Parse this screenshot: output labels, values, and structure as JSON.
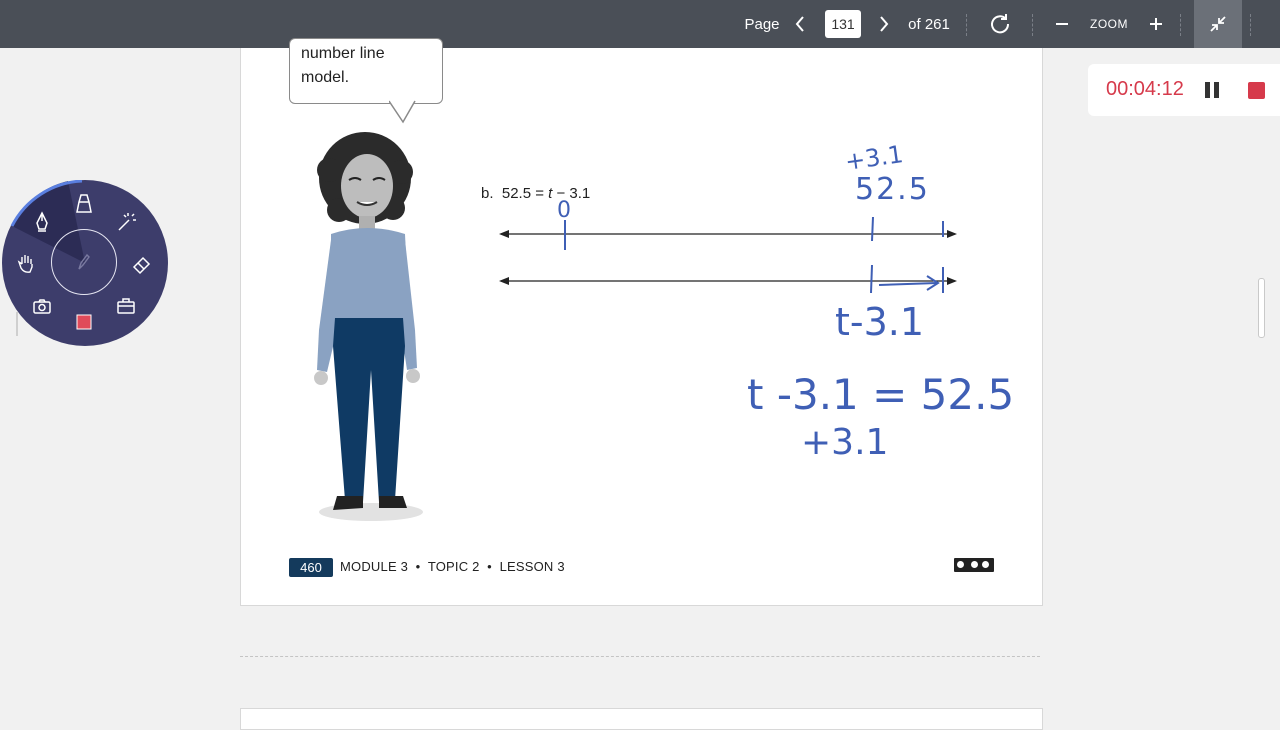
{
  "toolbar": {
    "page_label": "Page",
    "page_value": "131",
    "page_total": "of 261",
    "zoom_label": "ZOOM"
  },
  "page": {
    "bubble_text_line1": "number line",
    "bubble_text_line2": "model.",
    "problem_prefix": "b.",
    "problem_lhs": "52.5 =",
    "problem_var": "t",
    "problem_rhs": "− 3.1",
    "footer_page_number": "460",
    "footer_module": "MODULE 3",
    "footer_topic": "TOPIC 2",
    "footer_lesson": "LESSON 3",
    "handwriting": {
      "top_left_label": "+3.1",
      "top_value": "52.5",
      "start_label": "0",
      "below_line_label": "t-3.1",
      "equation": "t -3.1 = 52.5",
      "add_line": "+3.1"
    }
  },
  "timer": {
    "elapsed": "00:04:12"
  },
  "colors": {
    "toolbar_bg": "#4a4f57",
    "ink_blue": "#3f5fb5",
    "timer_red": "#d63a4b",
    "radial_bg": "#3d3d6b"
  },
  "radial_menu": {
    "icons": [
      "pen-icon",
      "highlighter-icon",
      "magic-wand-icon",
      "hand-icon",
      "eraser-icon",
      "camera-icon",
      "stop-icon",
      "toolbox-icon",
      "pencil-icon"
    ]
  }
}
